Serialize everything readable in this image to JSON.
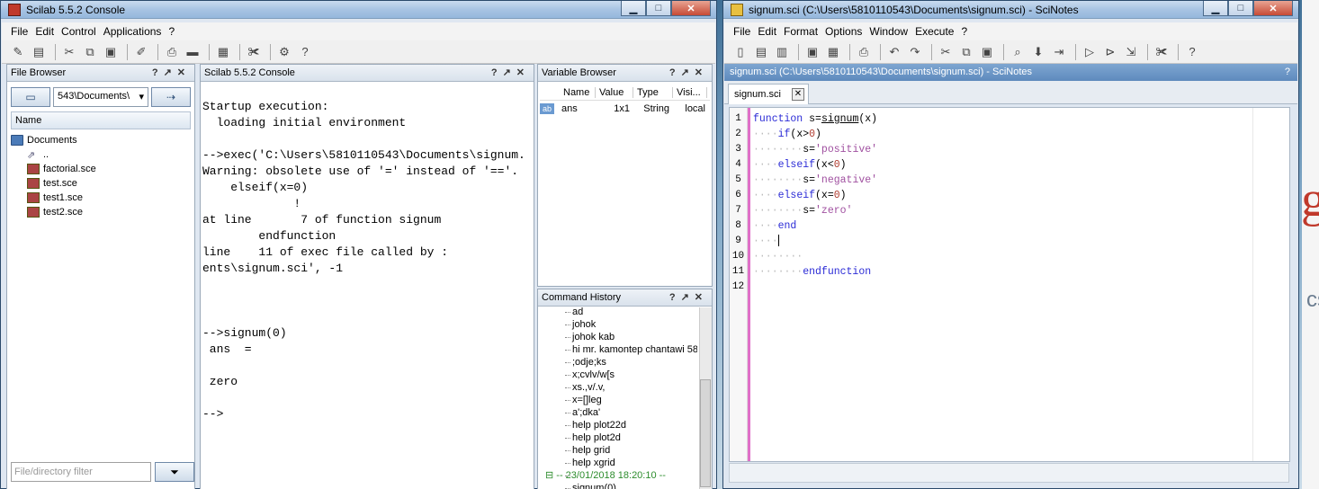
{
  "left_window": {
    "title": "Scilab 5.5.2 Console",
    "menu": [
      "File",
      "Edit",
      "Control",
      "Applications",
      "?"
    ],
    "toolbar_icons": [
      "new-script-icon",
      "open-icon",
      "cut-icon",
      "copy-icon",
      "paste-icon",
      "clear-icon",
      "print-icon",
      "variables-icon",
      "modules-icon",
      "preferences-icon",
      "config-icon",
      "help-icon"
    ]
  },
  "file_browser": {
    "title": "File Browser",
    "path_value": "543\\Documents\\",
    "column_name": "Name",
    "root": "Documents",
    "items": [
      "..",
      "factorial.sce",
      "test.sce",
      "test1.sce",
      "test2.sce"
    ],
    "filter_placeholder": "File/directory filter"
  },
  "console": {
    "title": "Scilab 5.5.2 Console",
    "lines": [
      "",
      "Startup execution:",
      "  loading initial environment",
      "",
      "-->exec('C:\\Users\\5810110543\\Documents\\signum.",
      "Warning: obsolete use of '=' instead of '=='.",
      "    elseif(x=0)",
      "             !",
      "at line       7 of function signum",
      "        endfunction",
      "line    11 of exec file called by :",
      "ents\\signum.sci', -1",
      "",
      "",
      "",
      "-->signum(0)",
      " ans  =",
      "",
      " zero",
      "",
      "-->"
    ]
  },
  "variable_browser": {
    "title": "Variable Browser",
    "columns": [
      "Name",
      "Value",
      "Type",
      "Visi..."
    ],
    "rows": [
      {
        "icon": "ab",
        "name": "ans",
        "value": "1x1",
        "type": "String",
        "vis": "local"
      }
    ]
  },
  "command_history": {
    "title": "Command History",
    "items": [
      "ad",
      "johok",
      "johok kab",
      "hi mr. kamontep chantawi 58",
      ";odje;ks",
      "x;cvlv/w[s",
      "xs.,v/.v,",
      "x=[]leg",
      "a';dka'",
      "help plot22d",
      "help plot2d",
      "help grid",
      "help xgrid"
    ],
    "session": "-- 23/01/2018 18:20:10 --",
    "after": [
      "signum(0)"
    ]
  },
  "right_window": {
    "title": "signum.sci (C:\\Users\\5810110543\\Documents\\signum.sci) - SciNotes",
    "menu": [
      "File",
      "Edit",
      "Format",
      "Options",
      "Window",
      "Execute",
      "?"
    ],
    "header": "signum.sci (C:\\Users\\5810110543\\Documents\\signum.sci) - SciNotes",
    "tab": "signum.sci",
    "line_numbers": [
      "1",
      "2",
      "3",
      "4",
      "5",
      "6",
      "7",
      "8",
      "9",
      "10",
      "11",
      "12"
    ]
  },
  "code": {
    "l1_kw": "function",
    "l1_rest": " s=",
    "l1_fn": "signum",
    "l1_tail": "(x)",
    "l2_kw": "if",
    "l2_arg": "(x>",
    "l2_num": "0",
    "l2_end": ")",
    "l3": "s=",
    "l3_str": "'positive'",
    "l4_kw": "elseif",
    "l4_arg": "(x<",
    "l4_num": "0",
    "l4_end": ")",
    "l5": "s=",
    "l5_str": "'negative'",
    "l6_kw": "elseif",
    "l6_arg": "(x=",
    "l6_num": "0",
    "l6_end": ")",
    "l7": "s=",
    "l7_str": "'zero'",
    "l8_kw": "end",
    "l11_kw": "endfunction"
  },
  "desktop_glyphs": {
    "g": "g",
    "cs": "cs"
  }
}
